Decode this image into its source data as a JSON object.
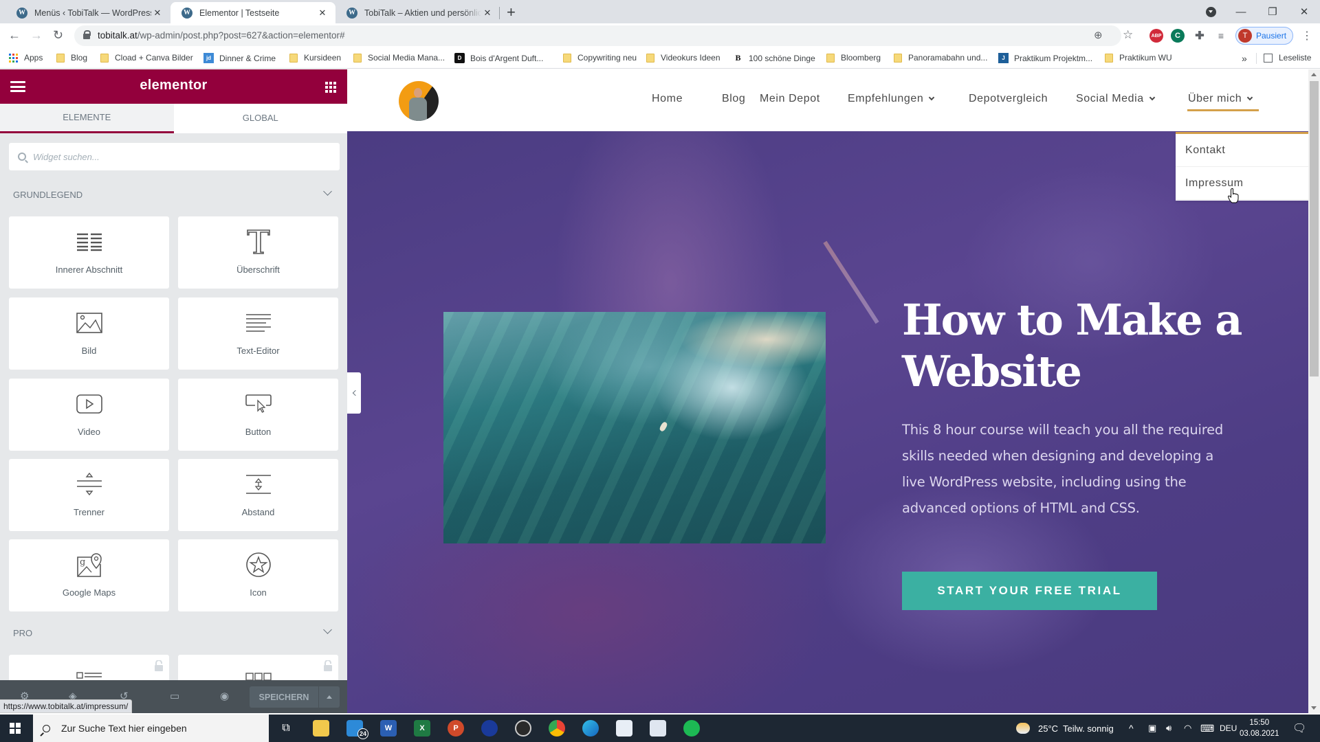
{
  "browser": {
    "tabs": [
      {
        "title": "Menüs ‹ TobiTalk — WordPress",
        "active": false
      },
      {
        "title": "Elementor | Testseite",
        "active": true
      },
      {
        "title": "TobiTalk – Aktien und persönliche",
        "active": false
      }
    ],
    "new_tab_label": "+",
    "url_host": "tobitalk.at",
    "url_path": "/wp-admin/post.php?post=627&action=elementor#",
    "profile_initial": "T",
    "profile_status": "Pausiert",
    "extensions": [
      "ABP",
      "C"
    ],
    "bookmarks": [
      {
        "label": "Apps",
        "type": "apps"
      },
      {
        "label": "Blog",
        "type": "folder"
      },
      {
        "label": "Cload + Canva Bilder",
        "type": "folder"
      },
      {
        "label": "Dinner & Crime",
        "type": "site",
        "badge": "jd",
        "color": "#3d8ad6"
      },
      {
        "label": "Kursideen",
        "type": "folder"
      },
      {
        "label": "Social Media Mana...",
        "type": "folder"
      },
      {
        "label": "Bois d'Argent Duft...",
        "type": "site",
        "badge": "D",
        "color": "#111111"
      },
      {
        "label": "Copywriting neu",
        "type": "folder"
      },
      {
        "label": "Videokurs Ideen",
        "type": "folder"
      },
      {
        "label": "100 schöne Dinge",
        "type": "site",
        "badge": "B",
        "color": "#ffffff"
      },
      {
        "label": "Bloomberg",
        "type": "folder"
      },
      {
        "label": "Panoramabahn und...",
        "type": "folder"
      },
      {
        "label": "Praktikum Projektm...",
        "type": "site",
        "badge": "J",
        "color": "#1e5f99"
      },
      {
        "label": "Praktikum WU",
        "type": "folder"
      }
    ],
    "bookmarks_overflow": "»",
    "reading_list": "Leseliste",
    "status_bar_url": "https://www.tobitalk.at/impressum/"
  },
  "elementor": {
    "logo": "elementor",
    "tabs": [
      {
        "label": "Elemente",
        "active": true
      },
      {
        "label": "Global",
        "active": false
      }
    ],
    "search_placeholder": "Widget suchen...",
    "sections": [
      {
        "title": "Grundlegend",
        "widgets": [
          {
            "label": "Innerer Abschnitt",
            "icon": "inner-section-icon"
          },
          {
            "label": "Überschrift",
            "icon": "heading-icon"
          },
          {
            "label": "Bild",
            "icon": "image-icon"
          },
          {
            "label": "Text-Editor",
            "icon": "text-editor-icon"
          },
          {
            "label": "Video",
            "icon": "video-icon"
          },
          {
            "label": "Button",
            "icon": "button-icon"
          },
          {
            "label": "Trenner",
            "icon": "divider-icon"
          },
          {
            "label": "Abstand",
            "icon": "spacer-icon"
          },
          {
            "label": "Google Maps",
            "icon": "google-maps-icon"
          },
          {
            "label": "Icon",
            "icon": "star-icon"
          }
        ]
      },
      {
        "title": "Pro",
        "widgets": [
          {
            "label": "",
            "icon": "posts-icon",
            "locked": true
          },
          {
            "label": "",
            "icon": "portfolio-icon",
            "locked": true
          }
        ]
      }
    ],
    "footer": {
      "save_label": "Speichern"
    }
  },
  "site": {
    "nav": [
      {
        "label": "Home",
        "has_dropdown": false
      },
      {
        "label": "Blog",
        "has_dropdown": false
      },
      {
        "label": "Mein Depot",
        "has_dropdown": false
      },
      {
        "label": "Empfehlungen",
        "has_dropdown": true
      },
      {
        "label": "Depotvergleich",
        "has_dropdown": false
      },
      {
        "label": "Social Media",
        "has_dropdown": true
      },
      {
        "label": "Über mich",
        "has_dropdown": true,
        "active": true
      }
    ],
    "dropdown": [
      "Kontakt",
      "Impressum"
    ],
    "accent_color": "#d4a04a",
    "hero": {
      "title_line1": "How to Make a",
      "title_line2": "Website",
      "text": "This 8 hour course will teach you all the required skills needed when designing and developing a live WordPress website, including using the advanced options of HTML and CSS.",
      "cta": "Start Your Free Trial",
      "cta_color": "#3bb0a2"
    }
  },
  "taskbar": {
    "search_placeholder": "Zur Suche Text hier eingeben",
    "mail_badge": "24",
    "weather": "25°C  Teilw. sonnig",
    "language": "DEU",
    "time": "15:50",
    "date": "03.08.2021"
  }
}
